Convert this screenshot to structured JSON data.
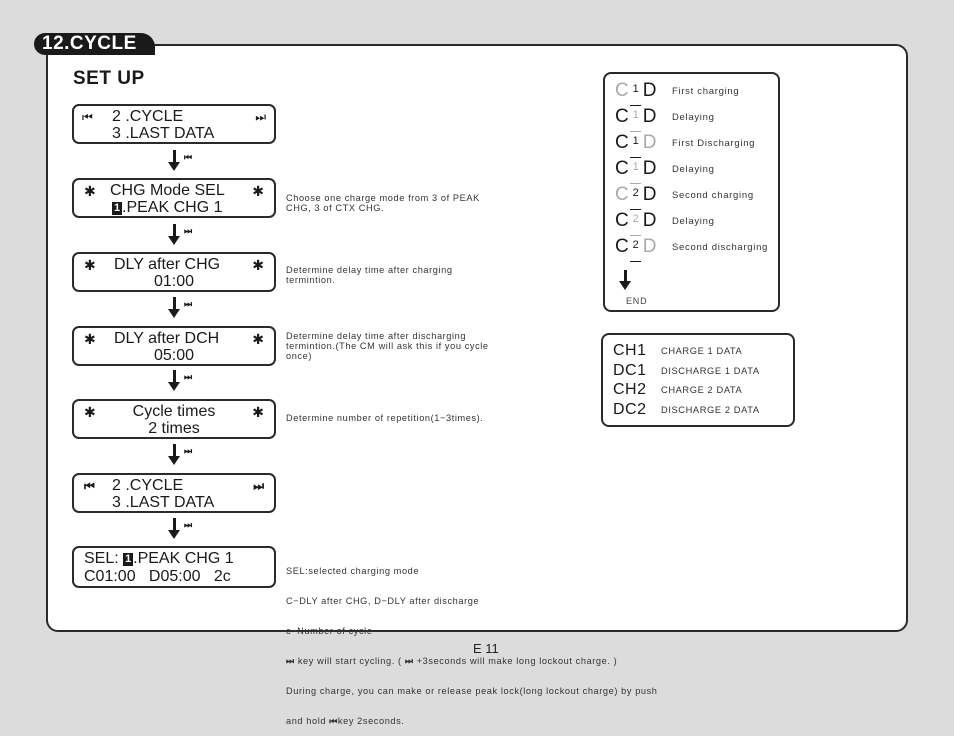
{
  "section_title": "12.CYCLE",
  "heading": "SET UP",
  "icons": {
    "skip_back": "⏮",
    "skip_forward": "⏭",
    "asterisk": "✱"
  },
  "lcd_screens": [
    {
      "line1": "2 .CYCLE",
      "line2": "3 .LAST DATA",
      "left_icon": "skip-back",
      "right_icon": "skip-forward"
    },
    {
      "line1": "CHG Mode SEL",
      "line2_badge": "1",
      "line2": ".PEAK CHG 1",
      "left_icon": "asterisk",
      "right_icon": "asterisk"
    },
    {
      "line1": "DLY after CHG",
      "line2": "01:00",
      "left_icon": "asterisk",
      "right_icon": "asterisk"
    },
    {
      "line1": "DLY after DCH",
      "line2": "05:00",
      "left_icon": "asterisk",
      "right_icon": "asterisk"
    },
    {
      "line1": "Cycle times",
      "line2": "2 times",
      "left_icon": "asterisk",
      "right_icon": "asterisk"
    },
    {
      "line1": "2 .CYCLE",
      "line2": "3 .LAST DATA",
      "left_icon": "skip-back",
      "right_icon": "skip-forward"
    },
    {
      "line1_prefix": "SEL:",
      "line1_badge": "1",
      "line1": ".PEAK CHG 1",
      "line2": "C01:00   D05:00   2c"
    }
  ],
  "flow_arrows": [
    {
      "key": "skip-back"
    },
    {
      "key": "skip-forward"
    },
    {
      "key": "skip-forward"
    },
    {
      "key": "skip-forward"
    },
    {
      "key": "skip-forward"
    },
    {
      "key": "skip-forward"
    }
  ],
  "descriptions": {
    "chg_mode": [
      "Choose one charge mode from 3 of PEAK",
      "CHG, 3 of CTX CHG."
    ],
    "dly_chg": [
      "Determine delay time after charging",
      "termintion."
    ],
    "dly_dch": [
      "Determine delay time after discharging",
      "termintion.(The CM will ask this if you cycle",
      "once)"
    ],
    "cycle_times": [
      "Determine number of repetition(1−3times)."
    ],
    "sel": {
      "line1": "SEL:selected charging mode",
      "line2": "C−DLY after CHG, D−DLY after discharge",
      "line3": "c−Number of cycle",
      "line4a": " key will start cycling. ( ",
      "line4b": " +3seconds will make long lockout charge. )",
      "line5": "During charge, you can make or release peak lock(long lockout charge) by push",
      "line6a": "and hold ",
      "line6b": "key 2seconds."
    }
  },
  "cycle_steps": [
    {
      "num": "1",
      "label": "First charging",
      "c_active": false,
      "d_active": true
    },
    {
      "num": "1",
      "label": "Delaying",
      "c_active": true,
      "d_active": true
    },
    {
      "num": "1",
      "label": "First Discharging",
      "c_active": true,
      "d_active": false
    },
    {
      "num": "1",
      "label": "Delaying",
      "c_active": true,
      "d_active": true
    },
    {
      "num": "2",
      "label": "Second charging",
      "c_active": false,
      "d_active": true
    },
    {
      "num": "2",
      "label": "Delaying",
      "c_active": true,
      "d_active": true
    },
    {
      "num": "2",
      "label": "Second discharging",
      "c_active": true,
      "d_active": false
    }
  ],
  "step_letters": {
    "c": "C",
    "d": "D"
  },
  "end_label": "END",
  "data_legend": [
    {
      "code": "CH1",
      "label": "CHARGE 1 DATA"
    },
    {
      "code": "DC1",
      "label": "DISCHARGE 1 DATA"
    },
    {
      "code": "CH2",
      "label": "CHARGE 2 DATA"
    },
    {
      "code": "DC2",
      "label": "DISCHARGE 2 DATA"
    }
  ],
  "page_number": "E 11"
}
